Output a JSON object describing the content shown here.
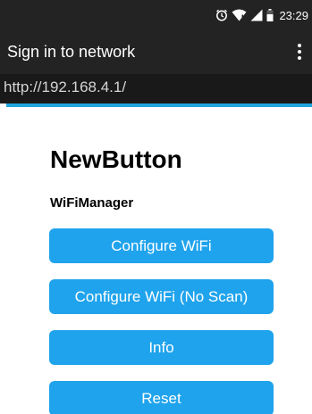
{
  "status_bar": {
    "time": "23:29",
    "icons": [
      "alarm-icon",
      "wifi-icon",
      "cell-signal-icon",
      "battery-icon"
    ]
  },
  "app_bar": {
    "title": "Sign in to network",
    "menu_icon": "overflow-menu-icon"
  },
  "url_bar": {
    "url": "http://192.168.4.1/"
  },
  "page": {
    "title": "NewButton",
    "subtitle": "WiFiManager",
    "buttons": [
      {
        "label": "Configure WiFi"
      },
      {
        "label": "Configure WiFi (No Scan)"
      },
      {
        "label": "Info"
      },
      {
        "label": "Reset"
      }
    ]
  },
  "colors": {
    "bar_background": "#232323",
    "url_background": "#191919",
    "accent": "#1fa5dd",
    "button": "#1fa3ec"
  }
}
